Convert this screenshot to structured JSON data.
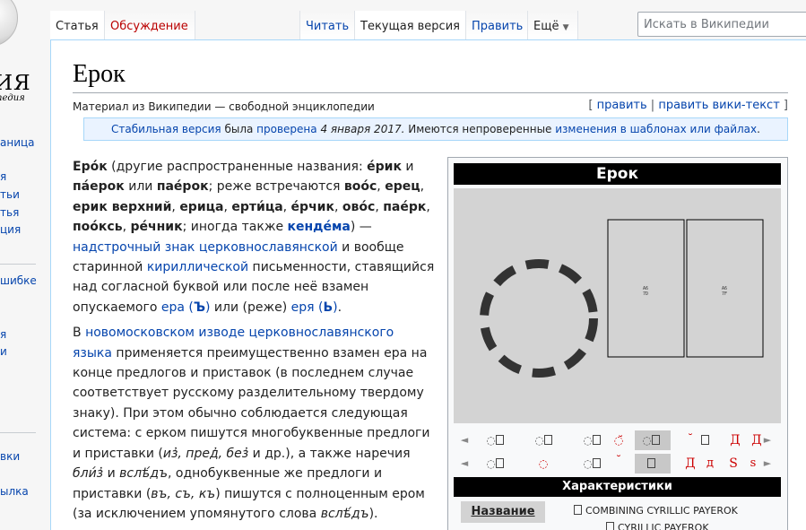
{
  "sidebar": {
    "logo_word": "ИЯ",
    "logo_sub": "педия",
    "items": [
      {
        "label": "аница"
      },
      {
        "label": "я"
      },
      {
        "label": "тьи"
      },
      {
        "label": "тья"
      },
      {
        "label": "ция"
      },
      {
        "label": "шибке"
      },
      {
        "label": "я"
      },
      {
        "label": "и"
      },
      {
        "label": "ы"
      },
      {
        "label": "вки"
      },
      {
        "label": "ылка"
      }
    ]
  },
  "tabs": {
    "article": "Статья",
    "talk": "Обсуждение",
    "read": "Читать",
    "current": "Текущая версия",
    "edit": "Править",
    "more": "Ещё"
  },
  "search": {
    "placeholder": "Искать в Википедии"
  },
  "page": {
    "title": "Ерок",
    "tagline": "Материал из Википедии — свободной энциклопедии",
    "edit_links": {
      "open": "[",
      "edit": "править",
      "sep": "|",
      "edit_wiki": "править вики-текст",
      "close": "]"
    },
    "flagged": {
      "stable": "Стабильная версия",
      "was": "была",
      "checked": "проверена",
      "date": "4 января 2017.",
      "rest": "Имеются непроверенные",
      "changes": "изменения в шаблонах или файлах",
      "dot": "."
    }
  },
  "body": {
    "p1": [
      {
        "t": "Еро́к",
        "b": true
      },
      {
        "t": " (другие распространенные названия: "
      },
      {
        "t": "е́рик",
        "b": true
      },
      {
        "t": " и "
      },
      {
        "t": "па́ерок",
        "b": true
      },
      {
        "t": " или "
      },
      {
        "t": "пае́рок",
        "b": true
      },
      {
        "t": "; реже встречаются "
      },
      {
        "t": "воо́с",
        "b": true
      },
      {
        "t": ", "
      },
      {
        "t": "ерец",
        "b": true
      },
      {
        "t": ", "
      },
      {
        "t": "ерик верхний",
        "b": true
      },
      {
        "t": ", "
      },
      {
        "t": "ерица",
        "b": true
      },
      {
        "t": ", "
      },
      {
        "t": "ерти́ца",
        "b": true
      },
      {
        "t": ", "
      },
      {
        "t": "е́рчик",
        "b": true
      },
      {
        "t": ", "
      },
      {
        "t": "ово́с",
        "b": true
      },
      {
        "t": ", "
      },
      {
        "t": "пае́рк",
        "b": true
      },
      {
        "t": ", "
      },
      {
        "t": "поо́ксь",
        "b": true
      },
      {
        "t": ", "
      },
      {
        "t": "ре́чник",
        "b": true
      },
      {
        "t": "; иногда также "
      },
      {
        "t": "кенде́ма",
        "b": true,
        "link": true
      },
      {
        "t": ") — "
      },
      {
        "t": "надстрочный знак церковнославянской",
        "link": true
      },
      {
        "t": " и вообще старинной "
      },
      {
        "t": "кириллической",
        "link": true
      },
      {
        "t": " письменности, ставящийся над согласной буквой или после неё взамен опускаемого "
      },
      {
        "t": "ера (",
        "link": true
      },
      {
        "t": "Ъ",
        "b": true,
        "link": true
      },
      {
        "t": ")",
        "link": true
      },
      {
        "t": " или (реже) "
      },
      {
        "t": "еря (",
        "link": true
      },
      {
        "t": "Ь",
        "b": true,
        "link": true
      },
      {
        "t": ")",
        "link": true
      },
      {
        "t": "."
      }
    ],
    "p2": [
      {
        "t": "В "
      },
      {
        "t": "новомосковском изводе церковнославянского языка",
        "link": true
      },
      {
        "t": " применяется преимущественно взамен ера на конце предлогов и приставок (в последнем случае соответствует русскому разделительному твердому знаку). При этом обычно соблюдается следующая система: с ерком пишутся многобуквенные предлоги и приставки ("
      },
      {
        "t": "из҆, пред҆, без҆",
        "i": true
      },
      {
        "t": " и др.), а также наречия "
      },
      {
        "t": "бли́з҆",
        "i": true
      },
      {
        "t": " и "
      },
      {
        "t": "вслѣ́дъ",
        "i": true
      },
      {
        "t": ", однобуквенные же предлоги и приставки ("
      },
      {
        "t": "въ, съ, къ",
        "i": true
      },
      {
        "t": ") пишутся с полноценным ером (за исключением упомянутого слова "
      },
      {
        "t": "вслѣ́дъ",
        "i": true
      },
      {
        "t": ")."
      }
    ]
  },
  "infobox": {
    "title": "Ерок",
    "glyph_codes": [
      "A6\n7D",
      "A6\n7F"
    ],
    "nav_row1": [
      "◄",
      "◌",
      "◌",
      "◌",
      "◌̆",
      "◌",
      "˘",
      "",
      "Д",
      "Д",
      "►"
    ],
    "nav_row2": [
      "◄",
      "◌",
      "◌",
      "◌",
      "˘",
      "",
      "Д",
      "д",
      "Ѕ",
      "Ѕ",
      "►"
    ],
    "characteristics": "Характеристики",
    "name_label": "Название",
    "name_values": [
      "COMBINING CYRILLIC PAYEROK",
      "CYRILLIC PAYEROK"
    ],
    "colors": {
      "header_bg": "#000000",
      "glyph_bg": "#d3d3d3",
      "red_letter": "#cc0000"
    }
  }
}
